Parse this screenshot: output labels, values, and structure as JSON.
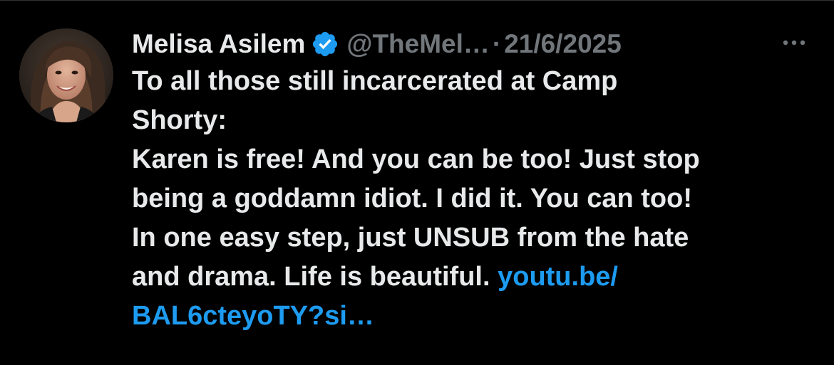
{
  "tweet": {
    "author": {
      "display_name": "Melisa Asilem",
      "handle": "@TheMel…",
      "verified": true,
      "avatar_icon": "avatar"
    },
    "separator": "·",
    "date": "21/6/2025",
    "more_icon": "more-horizontal-icon",
    "text_lines": [
      "To all those still incarcerated at Camp",
      "Shorty:",
      "Karen is free! And you can be too! Just stop",
      "being a goddamn idiot. I did it. You can too!",
      "In one easy step, just UNSUB from the hate"
    ],
    "last_line_text": "and drama. Life is beautiful. ",
    "link_part1": "youtu.be/",
    "link_part2": "BAL6cteyoTY?si…"
  },
  "colors": {
    "background": "#000000",
    "text": "#e7e9ea",
    "secondary": "#71767b",
    "link": "#1d9bf0",
    "verified": "#1d9bf0"
  }
}
